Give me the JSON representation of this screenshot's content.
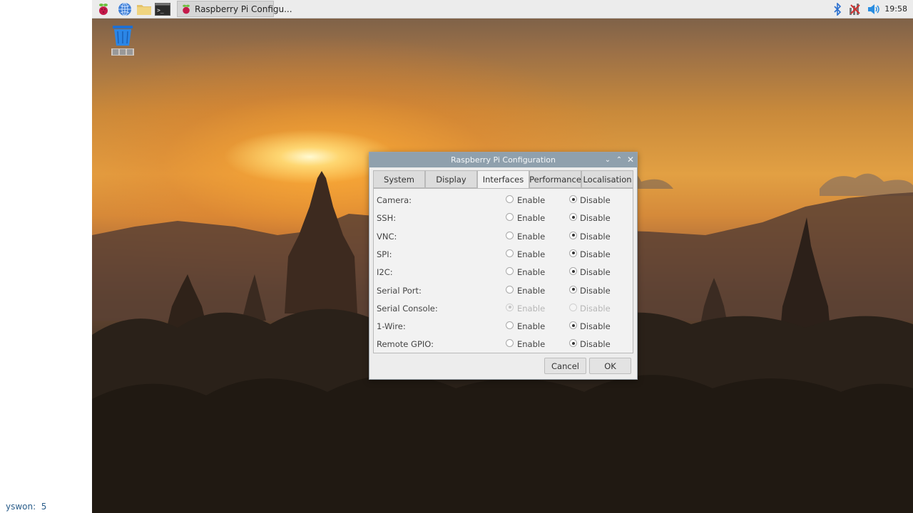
{
  "taskbar": {
    "task_title": "Raspberry Pi Configu...",
    "clock": "19:58",
    "icons": [
      "raspberry-menu-icon",
      "web-browser-icon",
      "file-manager-icon",
      "terminal-icon"
    ],
    "tray_icons": [
      "bluetooth-icon",
      "network-disconnected-icon",
      "volume-icon"
    ]
  },
  "desktop": {
    "icons": [
      "trash-icon"
    ]
  },
  "corner_label": "yswon:  5",
  "dialog": {
    "title": "Raspberry Pi Configuration",
    "tabs": [
      {
        "label": "System"
      },
      {
        "label": "Display"
      },
      {
        "label": "Interfaces"
      },
      {
        "label": "Performance"
      },
      {
        "label": "Localisation"
      }
    ],
    "active_tab": "Interfaces",
    "enable_label": "Enable",
    "disable_label": "Disable",
    "rows": [
      {
        "label": "Camera:",
        "selected": "Disable",
        "enabled": true
      },
      {
        "label": "SSH:",
        "selected": "Disable",
        "enabled": true
      },
      {
        "label": "VNC:",
        "selected": "Disable",
        "enabled": true
      },
      {
        "label": "SPI:",
        "selected": "Disable",
        "enabled": true
      },
      {
        "label": "I2C:",
        "selected": "Disable",
        "enabled": true
      },
      {
        "label": "Serial Port:",
        "selected": "Disable",
        "enabled": true
      },
      {
        "label": "Serial Console:",
        "selected": "Enable",
        "enabled": false
      },
      {
        "label": "1-Wire:",
        "selected": "Disable",
        "enabled": true
      },
      {
        "label": "Remote GPIO:",
        "selected": "Disable",
        "enabled": true
      }
    ],
    "buttons": {
      "cancel": "Cancel",
      "ok": "OK"
    }
  },
  "colors": {
    "taskbar_bg": "#ececec",
    "titlebar_bg": "#8fa0ad",
    "dialog_bg": "#ededed",
    "raspberry_red": "#c51a4a"
  }
}
